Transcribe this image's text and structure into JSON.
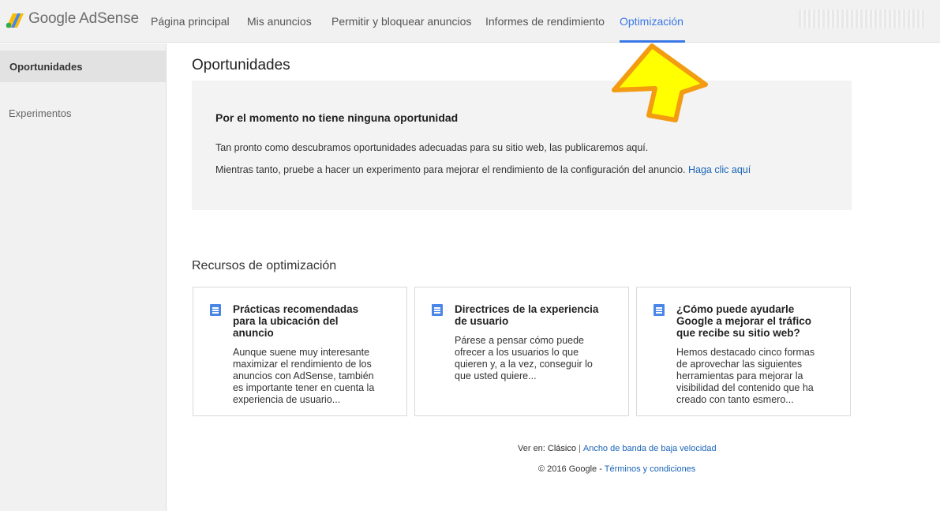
{
  "header": {
    "logo_text": "Google AdSense",
    "nav": [
      {
        "label": "Página principal"
      },
      {
        "label": "Mis anuncios"
      },
      {
        "label": "Permitir y bloquear anuncios"
      },
      {
        "label": "Informes de rendimiento"
      },
      {
        "label": "Optimización",
        "active": true
      }
    ],
    "accent_color": "#3b78e7"
  },
  "sidebar": {
    "items": [
      {
        "label": "Oportunidades",
        "active": true
      },
      {
        "label": "Experimentos"
      }
    ]
  },
  "main": {
    "title": "Oportunidades",
    "opportunities": {
      "heading": "Por el momento no tiene ninguna oportunidad",
      "line1": "Tan pronto como descubramos oportunidades adecuadas para su sitio web, las publicaremos aquí.",
      "line2": "Mientras tanto, pruebe a hacer un experimento para mejorar el rendimiento de la configuración del anuncio.",
      "link": "Haga clic aquí"
    },
    "resources": {
      "title": "Recursos de optimización",
      "cards": [
        {
          "icon": "document-icon",
          "title_lines": [
            "Prácticas recomendadas",
            "para la ubicación del",
            "anuncio"
          ],
          "desc_lines": [
            "Aunque suene muy interesante",
            "maximizar el rendimiento de los",
            "anuncios con AdSense, también",
            "es importante tener en cuenta la",
            "experiencia de usuario..."
          ]
        },
        {
          "icon": "document-icon",
          "title_lines": [
            "Directrices de la experiencia",
            "de usuario"
          ],
          "desc_lines": [
            "Párese a pensar cómo puede",
            "ofrecer a los usuarios lo que",
            "quieren y, a la vez, conseguir lo",
            "que usted quiere..."
          ]
        },
        {
          "icon": "document-icon",
          "title_lines": [
            "¿Cómo puede ayudarle",
            "Google a mejorar el tráfico",
            "que recibe su sitio web?"
          ],
          "desc_lines": [
            "Hemos destacado cinco formas",
            "de aprovechar las siguientes",
            "herramientas para mejorar la",
            "visibilidad del contenido que ha",
            "creado con tanto esmero..."
          ]
        }
      ]
    }
  },
  "footer": {
    "view_label": "Ver en:",
    "view_current": "Clásico",
    "separator": "|",
    "low_bandwidth": "Ancho de banda de baja velocidad",
    "copyright": "© 2016 Google -",
    "terms": "Términos y condiciones"
  },
  "annotation": {
    "icon": "arrow-up-icon",
    "color": "#ffff00",
    "outline": "#f39c12"
  }
}
